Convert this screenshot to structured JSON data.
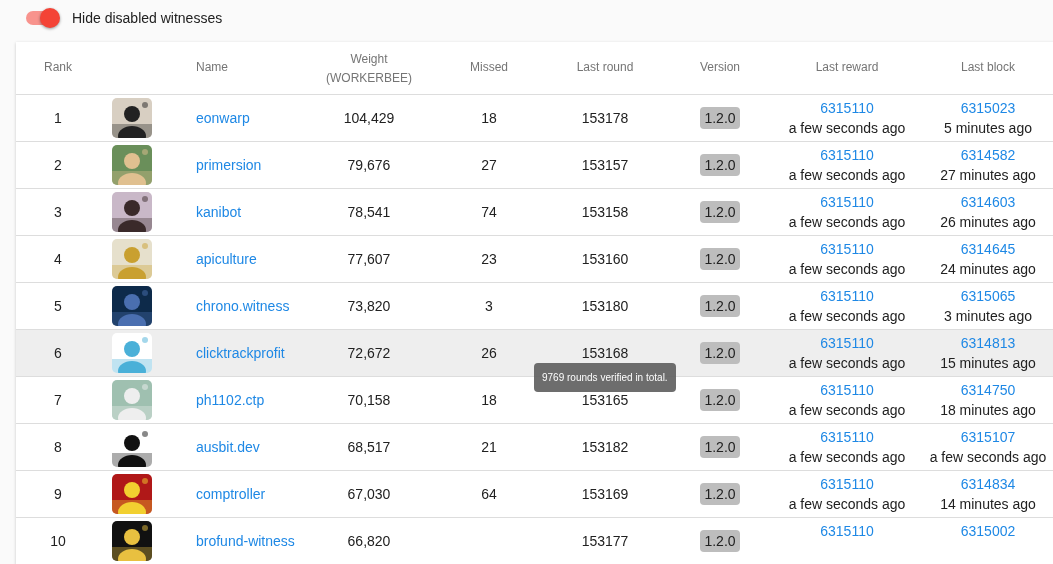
{
  "filter_toggle": {
    "label": "Hide disabled witnesses",
    "on": true
  },
  "table": {
    "columns": [
      "Rank",
      "",
      "Name",
      "Weight\n(WORKERBEE)",
      "Missed",
      "Last round",
      "Version",
      "Last reward",
      "Last block"
    ],
    "rows": [
      {
        "rank": "1",
        "name": "eonwarp",
        "weight": "104,429",
        "missed": "18",
        "last_round": "153178",
        "version": "1.2.0",
        "reward_block": "6315110",
        "reward_time": "a few seconds ago",
        "last_block": "6315023",
        "block_time": "5 minutes ago",
        "hovered": false
      },
      {
        "rank": "2",
        "name": "primersion",
        "weight": "79,676",
        "missed": "27",
        "last_round": "153157",
        "version": "1.2.0",
        "reward_block": "6315110",
        "reward_time": "a few seconds ago",
        "last_block": "6314582",
        "block_time": "27 minutes ago",
        "hovered": false
      },
      {
        "rank": "3",
        "name": "kanibot",
        "weight": "78,541",
        "missed": "74",
        "last_round": "153158",
        "version": "1.2.0",
        "reward_block": "6315110",
        "reward_time": "a few seconds ago",
        "last_block": "6314603",
        "block_time": "26 minutes ago",
        "hovered": false
      },
      {
        "rank": "4",
        "name": "apiculture",
        "weight": "77,607",
        "missed": "23",
        "last_round": "153160",
        "version": "1.2.0",
        "reward_block": "6315110",
        "reward_time": "a few seconds ago",
        "last_block": "6314645",
        "block_time": "24 minutes ago",
        "hovered": false
      },
      {
        "rank": "5",
        "name": "chrono.witness",
        "weight": "73,820",
        "missed": "3",
        "last_round": "153180",
        "version": "1.2.0",
        "reward_block": "6315110",
        "reward_time": "a few seconds ago",
        "last_block": "6315065",
        "block_time": "3 minutes ago",
        "hovered": false
      },
      {
        "rank": "6",
        "name": "clicktrackprofit",
        "weight": "72,672",
        "missed": "26",
        "last_round": "153168",
        "version": "1.2.0",
        "reward_block": "6315110",
        "reward_time": "a few seconds ago",
        "last_block": "6314813",
        "block_time": "15 minutes ago",
        "hovered": true
      },
      {
        "rank": "7",
        "name": "ph1102.ctp",
        "weight": "70,158",
        "missed": "18",
        "last_round": "153165",
        "version": "1.2.0",
        "reward_block": "6315110",
        "reward_time": "a few seconds ago",
        "last_block": "6314750",
        "block_time": "18 minutes ago",
        "hovered": false
      },
      {
        "rank": "8",
        "name": "ausbit.dev",
        "weight": "68,517",
        "missed": "21",
        "last_round": "153182",
        "version": "1.2.0",
        "reward_block": "6315110",
        "reward_time": "a few seconds ago",
        "last_block": "6315107",
        "block_time": "a few seconds ago",
        "hovered": false
      },
      {
        "rank": "9",
        "name": "comptroller",
        "weight": "67,030",
        "missed": "64",
        "last_round": "153169",
        "version": "1.2.0",
        "reward_block": "6315110",
        "reward_time": "a few seconds ago",
        "last_block": "6314834",
        "block_time": "14 minutes ago",
        "hovered": false
      },
      {
        "rank": "10",
        "name": "brofund-witness",
        "weight": "66,820",
        "last_round": "153177",
        "version": "1.2.0",
        "reward_block": "6315110",
        "last_block": "6315002",
        "hovered": false
      }
    ]
  },
  "tooltip": {
    "text": "9769 rounds verified in total."
  }
}
